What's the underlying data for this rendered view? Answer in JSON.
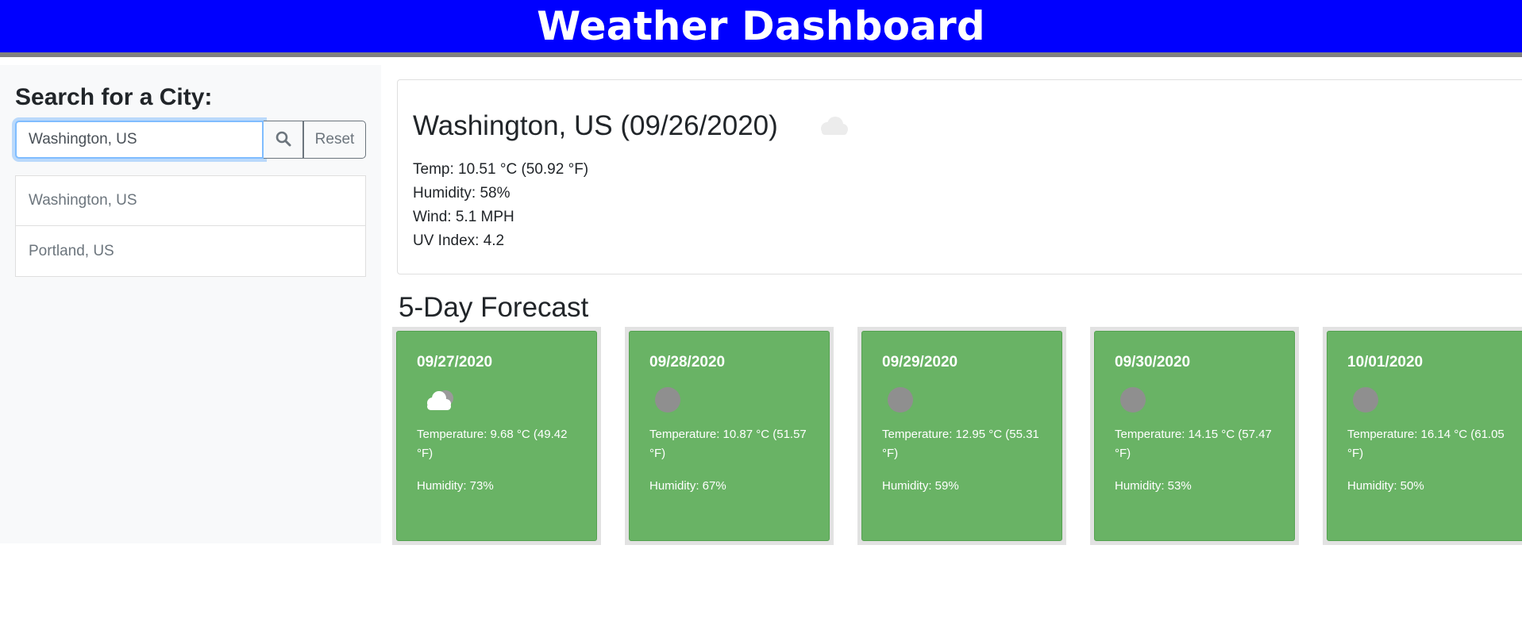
{
  "header": {
    "title": "Weather Dashboard"
  },
  "sidebar": {
    "heading": "Search for a City:",
    "search": {
      "value": "Washington, US",
      "reset_label": "Reset",
      "icon": "search-icon"
    },
    "history": [
      {
        "label": "Washington, US"
      },
      {
        "label": "Portland, US"
      }
    ]
  },
  "current": {
    "title": "Washington, US (09/26/2020)",
    "icon": "cloud-icon",
    "temp": "Temp: 10.51 °C (50.92 °F)",
    "humidity": "Humidity: 58%",
    "wind": "Wind: 5.1 MPH",
    "uv": "UV Index: 4.2"
  },
  "forecast": {
    "heading": "5-Day Forecast",
    "days": [
      {
        "date": "09/27/2020",
        "icon": "partly-cloudy-icon",
        "temp": "Temperature: 9.68 °C (49.42 °F)",
        "humidity": "Humidity: 73%"
      },
      {
        "date": "09/28/2020",
        "icon": "weather-icon",
        "temp": "Temperature: 10.87 °C (51.57 °F)",
        "humidity": "Humidity: 67%"
      },
      {
        "date": "09/29/2020",
        "icon": "weather-icon",
        "temp": "Temperature: 12.95 °C (55.31 °F)",
        "humidity": "Humidity: 59%"
      },
      {
        "date": "09/30/2020",
        "icon": "weather-icon",
        "temp": "Temperature: 14.15 °C (57.47 °F)",
        "humidity": "Humidity: 53%"
      },
      {
        "date": "10/01/2020",
        "icon": "weather-icon",
        "temp": "Temperature: 16.14 °C (61.05 °F)",
        "humidity": "Humidity: 50%"
      }
    ]
  },
  "colors": {
    "banner": "#0000ff",
    "banner_border": "#808080",
    "card_green": "#69b365",
    "sidebar_bg": "#f8f9fa"
  }
}
